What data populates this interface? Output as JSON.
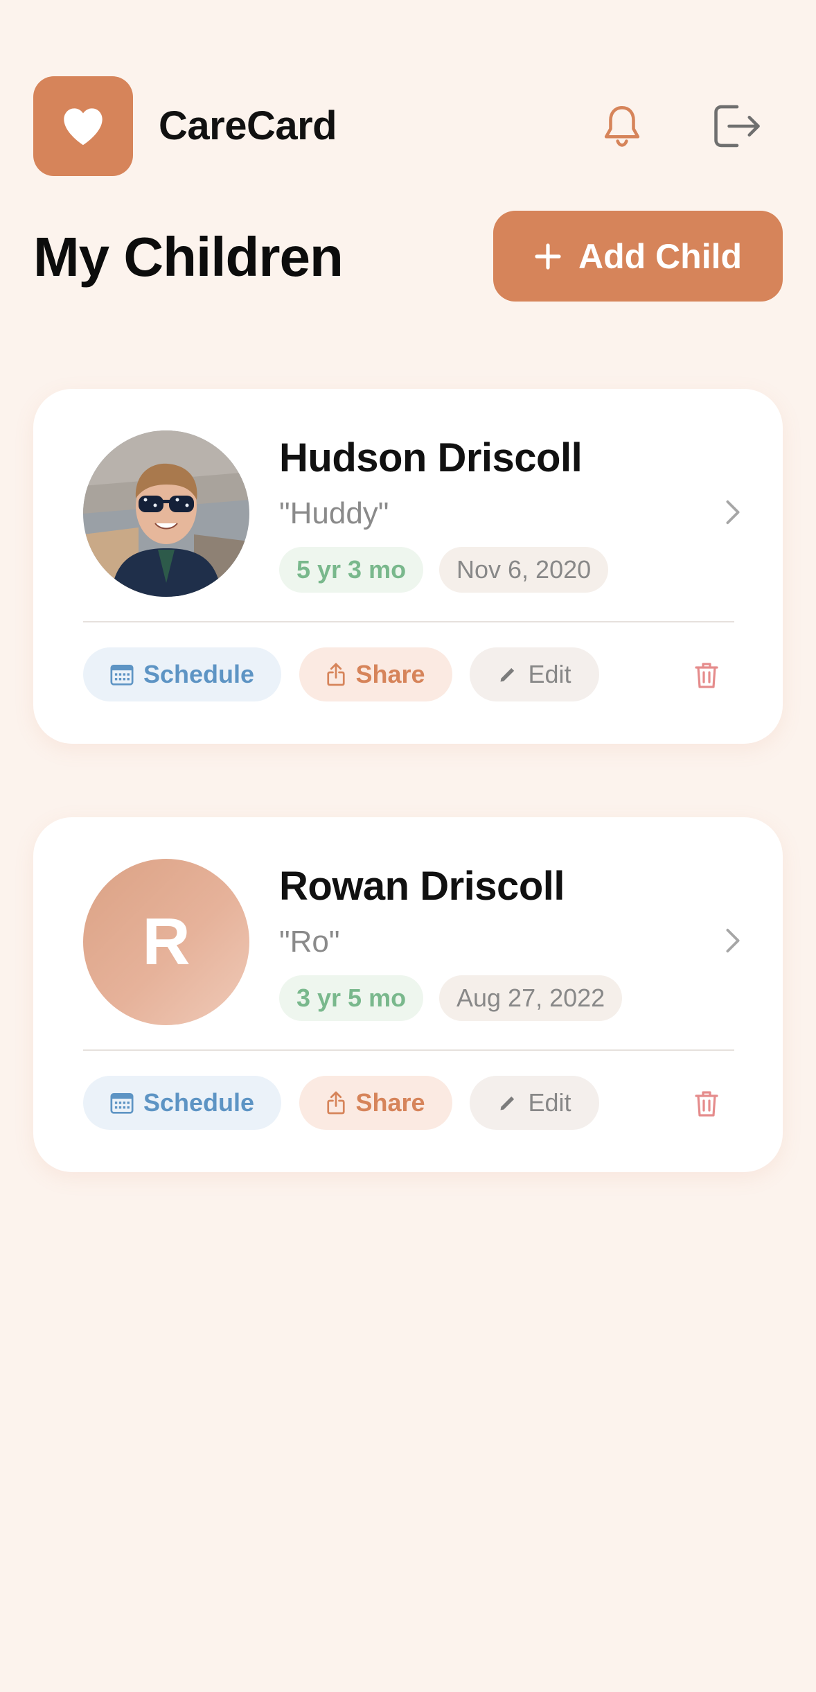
{
  "app": {
    "title": "CareCard",
    "accent_color": "#d6845a",
    "logo_icon": "heart-icon",
    "notifications_icon": "bell-icon",
    "logout_icon": "logout-icon"
  },
  "page": {
    "title": "My Children",
    "add_button_label": "Add Child",
    "add_button_icon": "plus-icon"
  },
  "children": [
    {
      "name": "Hudson Driscoll",
      "nickname": "\"Huddy\"",
      "age": "5 yr 3 mo",
      "birthdate": "Nov 6, 2020",
      "avatar_type": "photo",
      "actions": {
        "schedule": "Schedule",
        "share": "Share",
        "edit": "Edit"
      }
    },
    {
      "name": "Rowan Driscoll",
      "nickname": "\"Ro\"",
      "age": "3 yr 5 mo",
      "birthdate": "Aug 27, 2022",
      "avatar_type": "initial",
      "avatar_initial": "R",
      "actions": {
        "schedule": "Schedule",
        "share": "Share",
        "edit": "Edit"
      }
    }
  ],
  "colors": {
    "background": "#fcf3ed",
    "age_text": "#79b88c",
    "schedule_text": "#5d94c4",
    "delete_icon": "#e58c8c"
  }
}
